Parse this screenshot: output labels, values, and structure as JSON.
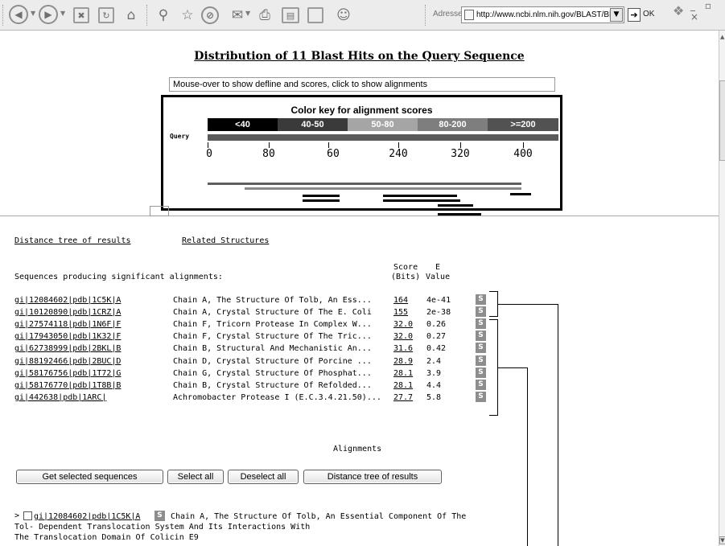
{
  "browser": {
    "address_label": "Adresse",
    "url": "http://www.ncbi.nlm.nih.gov/BLAST/Bl",
    "go_label": "OK",
    "window_controls": "_ ▫ ×",
    "toolbar_icons": [
      "back-icon",
      "forward-icon",
      "stop-icon",
      "refresh-icon",
      "home-icon",
      "search-icon",
      "favorites-icon",
      "history-icon",
      "mail-icon",
      "print-icon",
      "edit-icon",
      "discuss-icon",
      "messenger-icon"
    ]
  },
  "page": {
    "title": "Distribution of 11 Blast Hits on the Query Sequence",
    "hint": "Mouse-over to show defline and scores, click to show alignments",
    "color_key": {
      "title": "Color key for alignment scores",
      "segments": [
        {
          "label": "<40",
          "color": "#000000"
        },
        {
          "label": "40-50",
          "color": "#3a3a3a"
        },
        {
          "label": "50-80",
          "color": "#a5a5a5"
        },
        {
          "label": "80-200",
          "color": "#7e7e7e"
        },
        {
          "label": ">=200",
          "color": "#525252"
        }
      ]
    },
    "query_label": "Query",
    "axis_ticks": [
      "0",
      "80",
      "60",
      "240",
      "320",
      "400"
    ],
    "tree_link": "Distance tree of results",
    "related_link": "Related Structures",
    "header_left": "Sequences producing significant alignments:",
    "col_score_1": "Score",
    "col_score_2": "(Bits)",
    "col_e_1": "E",
    "col_e_2": "Value",
    "hits": [
      {
        "id": "gi|12084602|pdb|1C5K|A",
        "desc": "Chain A, The Structure Of Tolb, An Ess...",
        "score": "164",
        "evalue": "4e-41"
      },
      {
        "id": "gi|10120890|pdb|1CRZ|A",
        "desc": "Chain A, Crystal Structure Of The E. Coli",
        "score": "155",
        "evalue": "2e-38"
      },
      {
        "id": "gi|27574118|pdb|1N6F|F",
        "desc": "Chain F, Tricorn Protease In Complex W...",
        "score": "32.0",
        "evalue": "0.26"
      },
      {
        "id": "gi|17943050|pdb|1K32|F",
        "desc": "Chain F, Crystal Structure Of The Tric...",
        "score": "32.0",
        "evalue": "0.27"
      },
      {
        "id": "gi|62738999|pdb|2BKL|B",
        "desc": "Chain B, Structural And Mechanistic An...",
        "score": "31.6",
        "evalue": "0.42"
      },
      {
        "id": "gi|88192466|pdb|2BUC|D",
        "desc": "Chain D, Crystal Structure Of Porcine ...",
        "score": "28.9",
        "evalue": "2.4"
      },
      {
        "id": "gi|58176756|pdb|1T72|G",
        "desc": "Chain G, Crystal Structure Of Phosphat...",
        "score": "28.1",
        "evalue": "3.9"
      },
      {
        "id": "gi|58176770|pdb|1T8B|B",
        "desc": "Chain B, Crystal Structure Of Refolded...",
        "score": "28.1",
        "evalue": "4.4"
      },
      {
        "id": "gi|442638|pdb|1ARC|",
        "desc": "Achromobacter Protease I (E.C.3.4.21.50)...",
        "score": "27.7",
        "evalue": "5.8"
      }
    ],
    "structure_icon": "S",
    "alignments_heading": "Alignments",
    "buttons": {
      "get_selected": "Get selected sequences",
      "select_all": "Select all",
      "deselect_all": "Deselect all",
      "distance_tree": "Distance tree of results"
    },
    "alignment_entry": {
      "prefix": ">",
      "id": "gi|12084602|pdb|1C5K|A",
      "line1": "Chain A, The Structure Of Tolb, An Essential Component Of The",
      "line2": "Tol- Dependent Translocation System And Its Interactions With",
      "line3": "The Translocation Domain Of Colicin E9"
    }
  }
}
